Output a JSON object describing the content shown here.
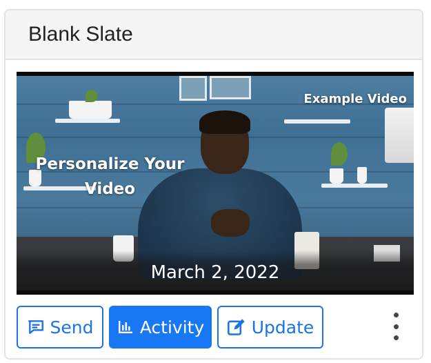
{
  "card": {
    "title": "Blank Slate"
  },
  "video": {
    "overlay_top_right": "Example Video",
    "overlay_headline_line1": "Personalize Your",
    "overlay_headline_line2": "Video",
    "date": "March 2, 2022"
  },
  "actions": {
    "send_label": "Send",
    "send_icon": "message-icon",
    "activity_label": "Activity",
    "activity_icon": "bar-chart-icon",
    "update_label": "Update",
    "update_icon": "edit-icon",
    "more_icon": "kebab-menu-icon"
  },
  "colors": {
    "accent": "#1877f2",
    "header_bg": "#f5f5f5",
    "border": "#e3e3e3"
  }
}
